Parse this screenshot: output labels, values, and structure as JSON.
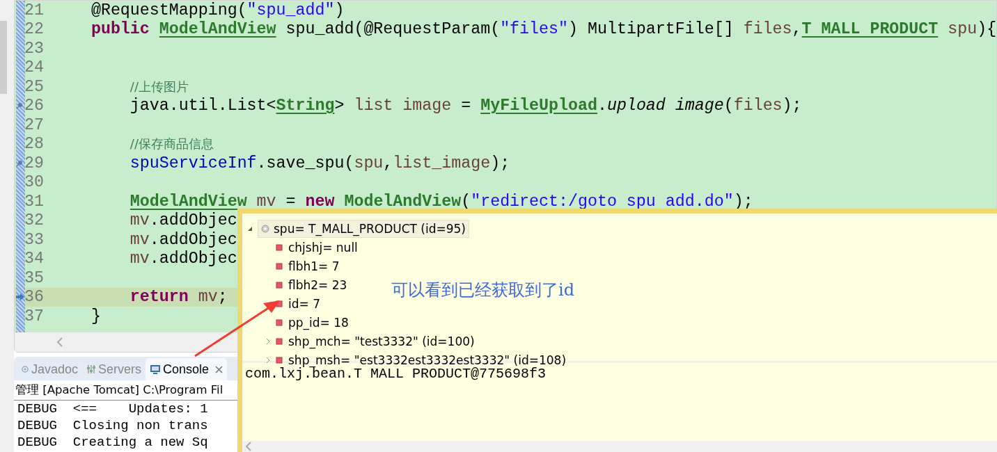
{
  "editor": {
    "lines": [
      {
        "number": "21",
        "current": false,
        "annotated": false,
        "tokens": [
          {
            "kind": "plain",
            "text": "    @RequestMapping("
          },
          {
            "kind": "string",
            "text": "\"spu_add\""
          },
          {
            "kind": "plain",
            "text": ")"
          }
        ]
      },
      {
        "number": "22",
        "current": false,
        "annotated": false,
        "tokens": [
          {
            "kind": "keyword",
            "text": "    public "
          },
          {
            "kind": "type",
            "text": "ModelAndView"
          },
          {
            "kind": "plain",
            "text": " spu_add(@RequestParam("
          },
          {
            "kind": "string",
            "text": "\"files\""
          },
          {
            "kind": "plain",
            "text": ") MultipartFile[] "
          },
          {
            "kind": "var",
            "text": "files"
          },
          {
            "kind": "plain",
            "text": ","
          },
          {
            "kind": "type",
            "text": "T MALL PRODUCT"
          },
          {
            "kind": "var",
            "text": " spu"
          },
          {
            "kind": "plain",
            "text": "){"
          }
        ]
      },
      {
        "number": "23",
        "current": false,
        "annotated": false
      },
      {
        "number": "24",
        "current": false,
        "annotated": false
      },
      {
        "number": "25",
        "current": false,
        "annotated": false,
        "tokens": [
          {
            "kind": "comment",
            "text": "        //上传图片"
          }
        ]
      },
      {
        "number": "26",
        "current": false,
        "annotated": true,
        "tokens": [
          {
            "kind": "plain",
            "text": "        java.util.List<"
          },
          {
            "kind": "type",
            "text": "String"
          },
          {
            "kind": "plain",
            "text": "> "
          },
          {
            "kind": "var",
            "text": "list image"
          },
          {
            "kind": "plain",
            "text": " = "
          },
          {
            "kind": "type",
            "text": "MyFileUpload"
          },
          {
            "kind": "plain",
            "text": "."
          },
          {
            "kind": "static",
            "text": "upload image"
          },
          {
            "kind": "plain",
            "text": "("
          },
          {
            "kind": "var",
            "text": "files"
          },
          {
            "kind": "plain",
            "text": ");"
          }
        ]
      },
      {
        "number": "27",
        "current": false,
        "annotated": false
      },
      {
        "number": "28",
        "current": false,
        "annotated": false,
        "tokens": [
          {
            "kind": "comment",
            "text": "        //保存商品信息"
          }
        ]
      },
      {
        "number": "29",
        "current": false,
        "annotated": true,
        "tokens": [
          {
            "kind": "field",
            "text": "        spuServiceInf"
          },
          {
            "kind": "plain",
            "text": ".save_spu("
          },
          {
            "kind": "var",
            "text": "spu"
          },
          {
            "kind": "plain",
            "text": ","
          },
          {
            "kind": "var",
            "text": "list_image"
          },
          {
            "kind": "plain",
            "text": ");"
          }
        ]
      },
      {
        "number": "30",
        "current": false,
        "annotated": false
      },
      {
        "number": "31",
        "current": false,
        "annotated": false,
        "tokens": [
          {
            "kind": "type",
            "text": "        ModelAndView"
          },
          {
            "kind": "var",
            "text": " mv"
          },
          {
            "kind": "plain",
            "text": " = "
          },
          {
            "kind": "keyword",
            "text": "new "
          },
          {
            "kind": "type",
            "text": "ModelAndView"
          },
          {
            "kind": "plain",
            "text": "("
          },
          {
            "kind": "string",
            "text": "\"redirect:/goto spu add.do\""
          },
          {
            "kind": "plain",
            "text": ");"
          }
        ]
      },
      {
        "number": "32",
        "current": false,
        "annotated": false,
        "tokens": [
          {
            "kind": "var",
            "text": "        mv"
          },
          {
            "kind": "plain",
            "text": ".addObjec"
          }
        ]
      },
      {
        "number": "33",
        "current": false,
        "annotated": false,
        "tokens": [
          {
            "kind": "var",
            "text": "        mv"
          },
          {
            "kind": "plain",
            "text": ".addObjec"
          }
        ]
      },
      {
        "number": "34",
        "current": false,
        "annotated": false,
        "tokens": [
          {
            "kind": "var",
            "text": "        mv"
          },
          {
            "kind": "plain",
            "text": ".addObjec"
          }
        ]
      },
      {
        "number": "35",
        "current": false,
        "annotated": false
      },
      {
        "number": "36",
        "current": true,
        "annotated": false,
        "tokens": [
          {
            "kind": "keyword",
            "text": "        return"
          },
          {
            "kind": "var",
            "text": " mv"
          },
          {
            "kind": "plain",
            "text": ";"
          }
        ]
      },
      {
        "number": "37",
        "current": false,
        "annotated": false,
        "tokens": [
          {
            "kind": "plain",
            "text": "    }"
          }
        ]
      }
    ]
  },
  "bottom_panel": {
    "tabs": [
      {
        "label": "Javadoc",
        "kind": "javadoc",
        "selected": false
      },
      {
        "label": "Servers",
        "kind": "servers",
        "selected": false
      },
      {
        "label": "Console",
        "kind": "console",
        "selected": true
      }
    ],
    "console_title": "管理 [Apache Tomcat] C:\\Program Fil",
    "console_lines": [
      "DEBUG  <==    Updates: 1",
      "DEBUG  Closing non trans",
      "DEBUG  Creating a new Sq"
    ]
  },
  "inspect_popup": {
    "root": {
      "label": "spu= T_MALL_PRODUCT  (id=95)",
      "expanded": true,
      "selected": true,
      "children": [
        {
          "label": "chjshj= null",
          "expandable": false,
          "selected": false
        },
        {
          "label": "flbh1= 7",
          "expandable": false,
          "selected": false
        },
        {
          "label": "flbh2= 23",
          "expandable": false,
          "selected": false
        },
        {
          "label": "id= 7",
          "expandable": false,
          "selected": false
        },
        {
          "label": "pp_id= 18",
          "expandable": false,
          "selected": false
        },
        {
          "label": "shp_mch= \"test3332\" (id=100)",
          "expandable": true,
          "selected": false
        },
        {
          "label": "shp_msh= \"est3332est3332est3332\" (id=108)",
          "expandable": true,
          "selected": false
        }
      ]
    },
    "detail": "com.lxj.bean.T MALL PRODUCT@775698f3",
    "annotation": "可以看到已经获取到了id"
  }
}
